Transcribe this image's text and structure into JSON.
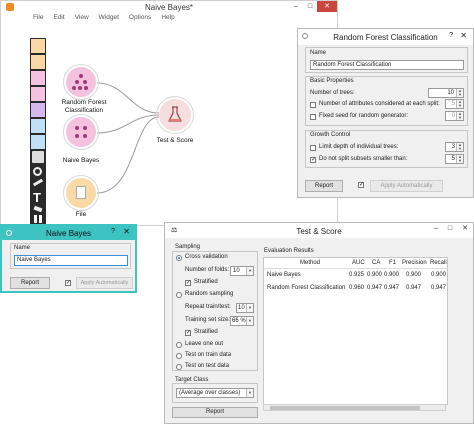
{
  "canvas": {
    "title": "Naive Bayes*",
    "menu": [
      "File",
      "Edit",
      "View",
      "Widget",
      "Options",
      "Help"
    ],
    "nodes": {
      "rf_label": "Random Forest Classification",
      "nb_label": "Naive Bayes",
      "file_label": "File",
      "ts_label": "Test & Score"
    }
  },
  "rf_window": {
    "title": "Random Forest Classification",
    "name_section": "Name",
    "name_value": "Random Forest Classification",
    "basic_section": "Basic Properties",
    "trees_label": "Number of trees:",
    "trees_value": "10",
    "attrs_label": "Number of attributes considered at each split:",
    "attrs_value": "5",
    "seed_label": "Fixed seed for random generator:",
    "seed_value": "0",
    "growth_section": "Growth Control",
    "depth_label": "Limit depth of individual trees:",
    "depth_value": "3",
    "subsets_label": "Do not split subsets smaller than:",
    "subsets_value": "5",
    "report_label": "Report",
    "apply_label": "Apply Automatically",
    "check_mark": "✓"
  },
  "nb_window": {
    "title": "Naive Bayes",
    "name_section": "Name",
    "name_value": "Naive Bayes",
    "report_label": "Report",
    "apply_label": "Apply Automatically",
    "check_mark": "✓"
  },
  "ts_window": {
    "title": "Test & Score",
    "sampling_section": "Sampling",
    "cv_label": "Cross validation",
    "folds_label": "Number of folds:",
    "folds_value": "10",
    "stratified_label": "Stratified",
    "random_label": "Random sampling",
    "repeat_label": "Repeat train/test:",
    "repeat_value": "10",
    "trainsize_label": "Training set size:",
    "trainsize_value": "66 %",
    "stratified2_label": "Stratified",
    "loo_label": "Leave one out",
    "train_data_label": "Test on train data",
    "test_data_label": "Test on test data",
    "target_section": "Target Class",
    "target_value": "(Average over classes)",
    "report_label": "Report",
    "results_title": "Evaluation Results",
    "columns": [
      "Method",
      "AUC",
      "CA",
      "F1",
      "Precision",
      "Recall"
    ],
    "rows": [
      [
        "Naive Bayes",
        "0.925",
        "0.900",
        "0.900",
        "0.900",
        "0.900"
      ],
      [
        "Random Forest Classification",
        "0.960",
        "0.947",
        "0.947",
        "0.947",
        "0.947"
      ]
    ],
    "check_mark": "✓"
  },
  "colors": {
    "rf_node": "#f5c2de",
    "nb_node": "#f5c2de",
    "file_node": "#fbd9a6",
    "ts_node": "#f7dede",
    "nb_window_frame": "#3ec3c3",
    "canvas_frame": "#d0d0d0"
  }
}
